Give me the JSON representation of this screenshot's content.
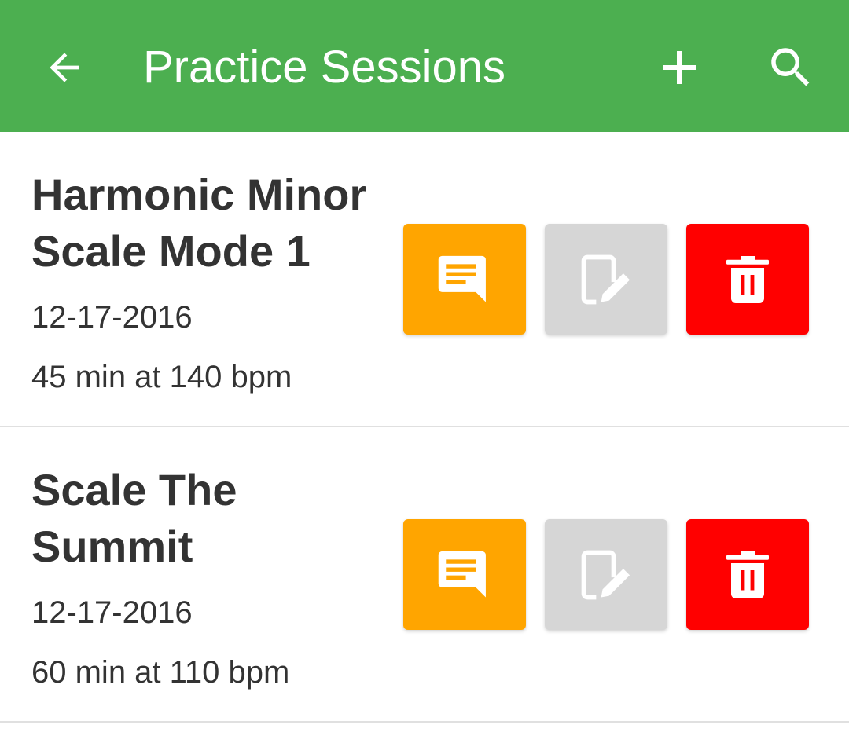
{
  "app_bar": {
    "title": "Practice Sessions",
    "background_color": "#4caf50",
    "icons": {
      "back": "arrow-back-icon",
      "add": "plus-icon",
      "search": "search-icon"
    }
  },
  "sessions": [
    {
      "name": "Harmonic Minor Scale Mode 1",
      "date": "12-17-2016",
      "duration": "45 min at 140 bpm"
    },
    {
      "name": "Scale The Summit",
      "date": "12-17-2016",
      "duration": "60 min at 110 bpm"
    }
  ],
  "actions": {
    "notes": {
      "icon": "notes-icon",
      "color": "#ffa500"
    },
    "edit": {
      "icon": "edit-icon",
      "color": "#d6d6d6"
    },
    "delete": {
      "icon": "trash-icon",
      "color": "#ff0000"
    }
  }
}
